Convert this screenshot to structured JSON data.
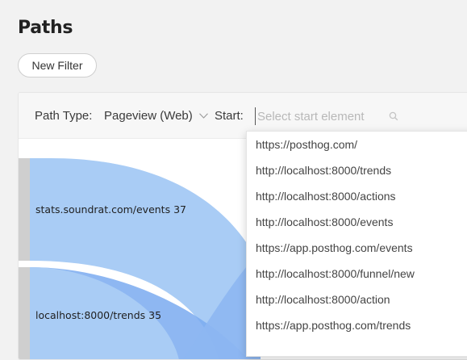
{
  "page": {
    "title": "Paths"
  },
  "toolbar": {
    "new_filter_label": "New Filter"
  },
  "filters": {
    "path_type_label": "Path Type:",
    "path_type_value": "Pageview (Web)",
    "start_label": "Start:",
    "start_placeholder": "Select start element",
    "start_value": ""
  },
  "sankey": {
    "nodes": [
      {
        "label": "stats.soundrat.com/events",
        "count": "37"
      },
      {
        "label": "localhost:8000/trends",
        "count": "35"
      }
    ],
    "colors": {
      "link": "#a9ccf5",
      "link_dark": "#7aaaf0",
      "node": "#cfcfcf"
    }
  },
  "dropdown": {
    "options": [
      "https://posthog.com/",
      "http://localhost:8000/trends",
      "http://localhost:8000/actions",
      "http://localhost:8000/events",
      "https://app.posthog.com/events",
      "http://localhost:8000/funnel/new",
      "http://localhost:8000/action",
      "https://app.posthog.com/trends"
    ]
  }
}
